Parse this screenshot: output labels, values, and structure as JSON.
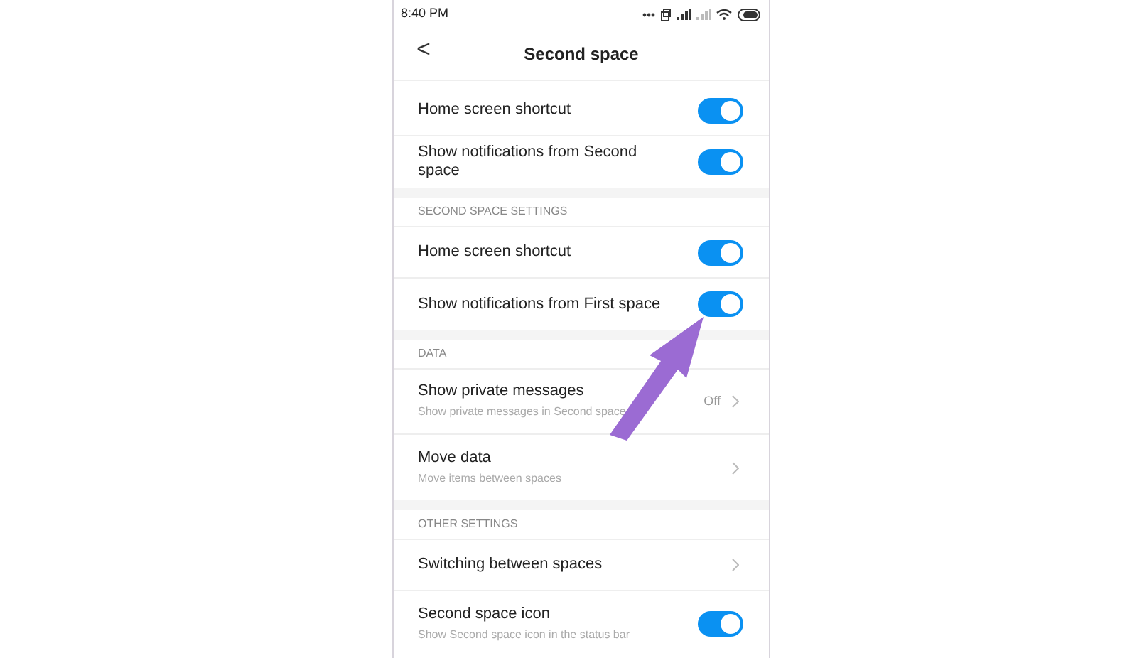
{
  "status_bar": {
    "time": "8:40 PM"
  },
  "header": {
    "back": "<",
    "title": "Second space"
  },
  "sections": [
    {
      "items": [
        {
          "kind": "toggle",
          "label": "Home screen shortcut",
          "on": true
        },
        {
          "kind": "toggle",
          "label": "Show notifications from Second space",
          "on": true
        }
      ]
    },
    {
      "heading": "SECOND SPACE SETTINGS",
      "items": [
        {
          "kind": "toggle",
          "label": "Home screen shortcut",
          "on": true
        },
        {
          "kind": "toggle",
          "label": "Show notifications from First space",
          "on": true
        }
      ]
    },
    {
      "heading": "DATA",
      "items": [
        {
          "kind": "link",
          "label": "Show private messages",
          "subtitle": "Show private messages in Second space",
          "value": "Off"
        },
        {
          "kind": "link",
          "label": "Move data",
          "subtitle": "Move items between spaces"
        }
      ]
    },
    {
      "heading": "OTHER SETTINGS",
      "items": [
        {
          "kind": "link",
          "label": "Switching between spaces"
        },
        {
          "kind": "toggle",
          "label": "Second space icon",
          "subtitle": "Show Second space icon in the status bar",
          "on": true
        }
      ]
    }
  ]
}
